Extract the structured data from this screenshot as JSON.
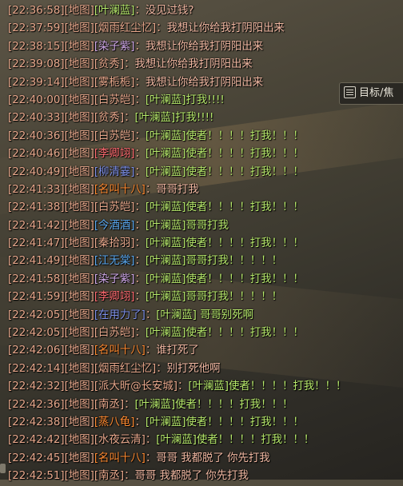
{
  "side_tab": {
    "label": "目标/焦"
  },
  "colors": {
    "time": "#e8a88c",
    "message": "#f1b8a2",
    "ye_lanlan": "#b6e86b"
  },
  "chat": [
    {
      "time": "[22:36:58]",
      "channel": "[地图]",
      "name": "[叶澜蓝]",
      "name_color": "#b6e86b",
      "sep": "：",
      "msg": "没见过钱?",
      "msg_color": "#f1b8a2"
    },
    {
      "time": "[22:37:59]",
      "channel": "[地图]",
      "name": "[烟雨红尘忆]",
      "name_color": "#e8a88c",
      "sep": "：",
      "msg": "我想让你给我打阴阳出来",
      "msg_color": "#f1b8a2"
    },
    {
      "time": "[22:38:15]",
      "channel": "[地图]",
      "name": "[染子紫]",
      "name_color": "#cfa7e8",
      "sep": "：",
      "msg": "我想让你给我打阴阳出来",
      "msg_color": "#f1b8a2"
    },
    {
      "time": "[22:39:08]",
      "channel": "[地图]",
      "name": "[贫秀]",
      "name_color": "#e8a88c",
      "sep": "：",
      "msg": "我想让你给我打阴阳出来",
      "msg_color": "#f1b8a2"
    },
    {
      "time": "[22:39:14]",
      "channel": "[地图]",
      "name": "[雾栀栀]",
      "name_color": "#e8a88c",
      "sep": "：",
      "msg": "我想让你给我打阴阳出来",
      "msg_color": "#f1b8a2"
    },
    {
      "time": "[22:40:00]",
      "channel": "[地图]",
      "name": "[白苏皑]",
      "name_color": "#e8a88c",
      "sep": "：",
      "msg": "[叶澜蓝]打我!!!!",
      "msg_color": "#b6e86b"
    },
    {
      "time": "[22:40:33]",
      "channel": "[地图]",
      "name": "[贫秀]",
      "name_color": "#e8a88c",
      "sep": "：",
      "msg": "[叶澜蓝]打我!!!!",
      "msg_color": "#b6e86b"
    },
    {
      "time": "[22:40:36]",
      "channel": "[地图]",
      "name": "[白苏皑]",
      "name_color": "#e8a88c",
      "sep": "：",
      "msg": "[叶澜蓝]使者！！！！打我！！！",
      "msg_color": "#b6e86b"
    },
    {
      "time": "[22:40:46]",
      "channel": "[地图]",
      "name": "[李卿翊]",
      "name_color": "#ff6a70",
      "sep": "：",
      "msg": "[叶澜蓝]使者！！！！打我！！！",
      "msg_color": "#b6e86b"
    },
    {
      "time": "[22:40:49]",
      "channel": "[地图]",
      "name": "[柳清霎]",
      "name_color": "#7c8fe8",
      "sep": "：",
      "msg": "[叶澜蓝]使者！！！！打我！！！",
      "msg_color": "#b6e86b"
    },
    {
      "time": "[22:41:33]",
      "channel": "[地图]",
      "name": "[名叫十八]",
      "name_color": "#ff8a30",
      "sep": "：",
      "msg": "哥哥打我",
      "msg_color": "#f1b8a2"
    },
    {
      "time": "[22:41:38]",
      "channel": "[地图]",
      "name": "[白苏皑]",
      "name_color": "#e8a88c",
      "sep": "：",
      "msg": "[叶澜蓝]使者！！！！打我！！！",
      "msg_color": "#b6e86b"
    },
    {
      "time": "[22:41:42]",
      "channel": "[地图]",
      "name": "[今酒酒]",
      "name_color": "#5aa8f0",
      "sep": "：",
      "msg": "[叶澜蓝]哥哥打我",
      "msg_color": "#b6e86b"
    },
    {
      "time": "[22:41:47]",
      "channel": "[地图]",
      "name": "[秦拾羽]",
      "name_color": "#e8a88c",
      "sep": "：",
      "msg": "[叶澜蓝]使者！！！！打我！！！",
      "msg_color": "#b6e86b"
    },
    {
      "time": "[22:41:49]",
      "channel": "[地图]",
      "name": "[江无棠]",
      "name_color": "#5aa8f0",
      "sep": "：",
      "msg": "[叶澜蓝]哥哥打我！！！！！",
      "msg_color": "#b6e86b"
    },
    {
      "time": "[22:41:58]",
      "channel": "[地图]",
      "name": "[染子紫]",
      "name_color": "#cfa7e8",
      "sep": "：",
      "msg": "[叶澜蓝]使者！！！！打我！！！",
      "msg_color": "#b6e86b"
    },
    {
      "time": "[22:41:59]",
      "channel": "[地图]",
      "name": "[李卿翊]",
      "name_color": "#ff6a70",
      "sep": "：",
      "msg": "[叶澜蓝]哥哥打我！！！！！",
      "msg_color": "#b6e86b"
    },
    {
      "time": "[22:42:05]",
      "channel": "[地图]",
      "name": "[在用力了]",
      "name_color": "#7c8fe8",
      "sep": "：",
      "msg": "[叶澜蓝] 哥哥别死啊",
      "msg_color": "#b6e86b"
    },
    {
      "time": "[22:42:05]",
      "channel": "[地图]",
      "name": "[白苏皑]",
      "name_color": "#e8a88c",
      "sep": "：",
      "msg": "[叶澜蓝]使者！！！！打我！！！",
      "msg_color": "#b6e86b"
    },
    {
      "time": "[22:42:06]",
      "channel": "[地图]",
      "name": "[名叫十八]",
      "name_color": "#ff8a30",
      "sep": "：",
      "msg": "谁打死了",
      "msg_color": "#f1b8a2"
    },
    {
      "time": "[22:42:14]",
      "channel": "[地图]",
      "name": "[烟雨红尘忆]",
      "name_color": "#e8a88c",
      "sep": "：",
      "msg": "别打死他啊",
      "msg_color": "#f1b8a2"
    },
    {
      "time": "[22:42:32]",
      "channel": "[地图]",
      "name": "[派大昕@长安城]",
      "name_color": "#e8a88c",
      "sep": "：",
      "msg": "[叶澜蓝]使者！！！！打我！！！",
      "msg_color": "#b6e86b"
    },
    {
      "time": "[22:42:36]",
      "channel": "[地图]",
      "name": "[南丞]",
      "name_color": "#e8a88c",
      "sep": "：",
      "msg": "[叶澜蓝]使者！！！！打我！！！",
      "msg_color": "#b6e86b"
    },
    {
      "time": "[22:42:38]",
      "channel": "[地图]",
      "name": "[蒸八龟]",
      "name_color": "#ff8a30",
      "sep": "：",
      "msg": "[叶澜蓝]使者！！！！打我！！！",
      "msg_color": "#b6e86b"
    },
    {
      "time": "[22:42:42]",
      "channel": "[地图]",
      "name": "[水夜云清]",
      "name_color": "#e8a88c",
      "sep": "：",
      "msg": "[叶澜蓝]使者！！！！打我！！！",
      "msg_color": "#b6e86b"
    },
    {
      "time": "[22:42:45]",
      "channel": "[地图]",
      "name": "[名叫十八]",
      "name_color": "#ff8a30",
      "sep": "：",
      "msg": "哥哥 我都脱了 你先打我",
      "msg_color": "#f1b8a2"
    },
    {
      "time": "[22:42:51]",
      "channel": "[地图]",
      "name": "[南丞]",
      "name_color": "#e8a88c",
      "sep": "：",
      "msg": "哥哥 我都脱了 你先打我",
      "msg_color": "#f1b8a2"
    }
  ]
}
